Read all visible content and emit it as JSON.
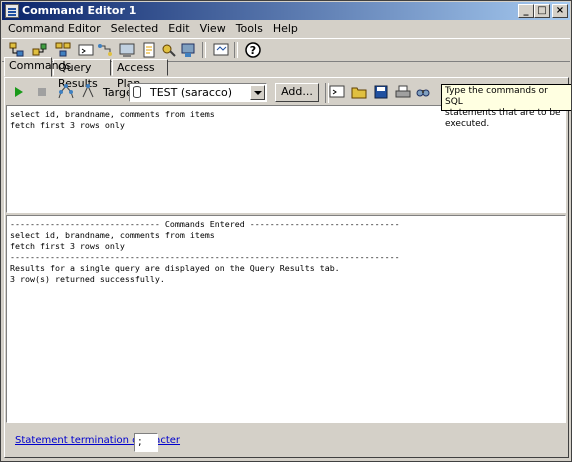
{
  "window": {
    "title": "Command Editor 1",
    "controls": [
      "_",
      "□",
      "×"
    ]
  },
  "menu": [
    "Command Editor",
    "Selected",
    "Edit",
    "View",
    "Tools",
    "Help"
  ],
  "toolbar_icons": [
    "object-tree-icon",
    "control-center-icon",
    "replication-icon",
    "command-center-icon",
    "task-center-icon",
    "health-center-icon",
    "journal-icon",
    "license-center-icon",
    "development-center-icon",
    "information-center-icon",
    "tools-settings-icon",
    "help-icon"
  ],
  "tabs": [
    {
      "label": "Commands",
      "active": true
    },
    {
      "label": "Query Results",
      "active": false
    },
    {
      "label": "Access Plan",
      "active": false
    }
  ],
  "command_toolbar": {
    "target_label": "Target",
    "target_value": "TEST (saracco)",
    "add_label": "Add..."
  },
  "tooltip": {
    "line1": "Type the commands or SQL",
    "line2": "statements that are to be executed."
  },
  "editor": {
    "text": "select id, brandname, comments from items\nfetch first 3 rows only"
  },
  "output": {
    "text": "------------------------------ Commands Entered ------------------------------\nselect id, brandname, comments from items\nfetch first 3 rows only\n------------------------------------------------------------------------------\nResults for a single query are displayed on the Query Results tab.\n3 row(s) returned successfully."
  },
  "footer": {
    "link_label": "Statement termination character",
    "termination_value": ";"
  },
  "colors": {
    "titlebar": "#0a246a",
    "face": "#d4d0c8",
    "tooltip": "#ffffe1",
    "link": "#0000cc"
  }
}
